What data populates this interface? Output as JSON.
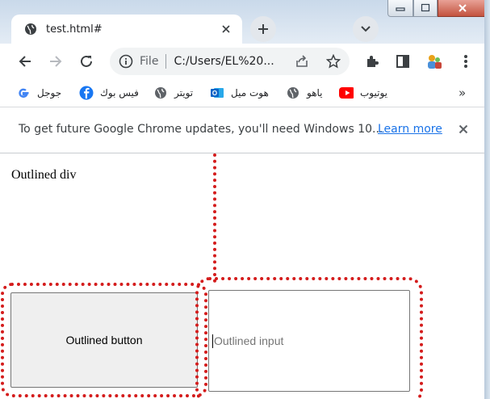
{
  "window": {
    "min_label": "▭",
    "max_label": "▢",
    "close_label": "✕"
  },
  "tab": {
    "title": "test.html#",
    "close_icon": "✕"
  },
  "toolbar": {
    "omnibox": {
      "scheme_label": "File",
      "url": "C:/Users/EL%20..."
    }
  },
  "bookmarks": [
    {
      "label": "جوجل",
      "icon": "google-icon",
      "color": "#4285f4"
    },
    {
      "label": "فيس بوك",
      "icon": "facebook-icon",
      "color": "#1877f2"
    },
    {
      "label": "تويتر",
      "icon": "globe-icon",
      "color": "#5f6368"
    },
    {
      "label": "هوت ميل",
      "icon": "outlook-icon",
      "color": "#0a64c7"
    },
    {
      "label": "ياهو",
      "icon": "globe-icon",
      "color": "#5f6368"
    },
    {
      "label": "يوتيوب",
      "icon": "youtube-icon",
      "color": "#ff0000"
    }
  ],
  "bookmarks_overflow": "»",
  "infobar": {
    "message": "To get future Google Chrome updates, you'll need Windows 10...",
    "link": "Learn more"
  },
  "page": {
    "div_text": "Outlined div",
    "button_label": "Outlined button",
    "input_placeholder": "Outlined input"
  },
  "colors": {
    "outline": "#d41c1c",
    "link": "#1a73e8"
  }
}
